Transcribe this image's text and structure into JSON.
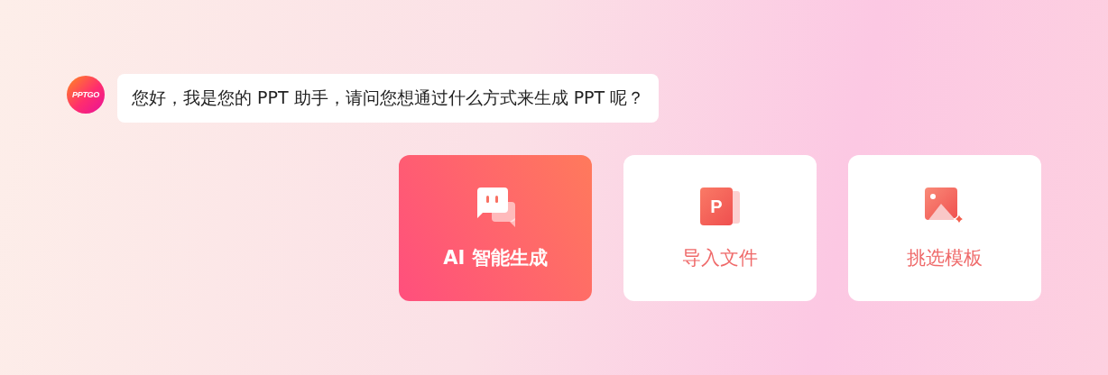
{
  "assistant": {
    "avatar_text": "PPTGO",
    "message": "您好，我是您的 PPT 助手，请问您想通过什么方式来生成 PPT 呢？"
  },
  "options": [
    {
      "kind": "chat",
      "label": "AI 智能生成",
      "selected": true
    },
    {
      "kind": "ppt",
      "label": "导入文件",
      "icon_text": "P",
      "selected": false
    },
    {
      "kind": "image",
      "label": "挑选模板",
      "selected": false
    }
  ]
}
